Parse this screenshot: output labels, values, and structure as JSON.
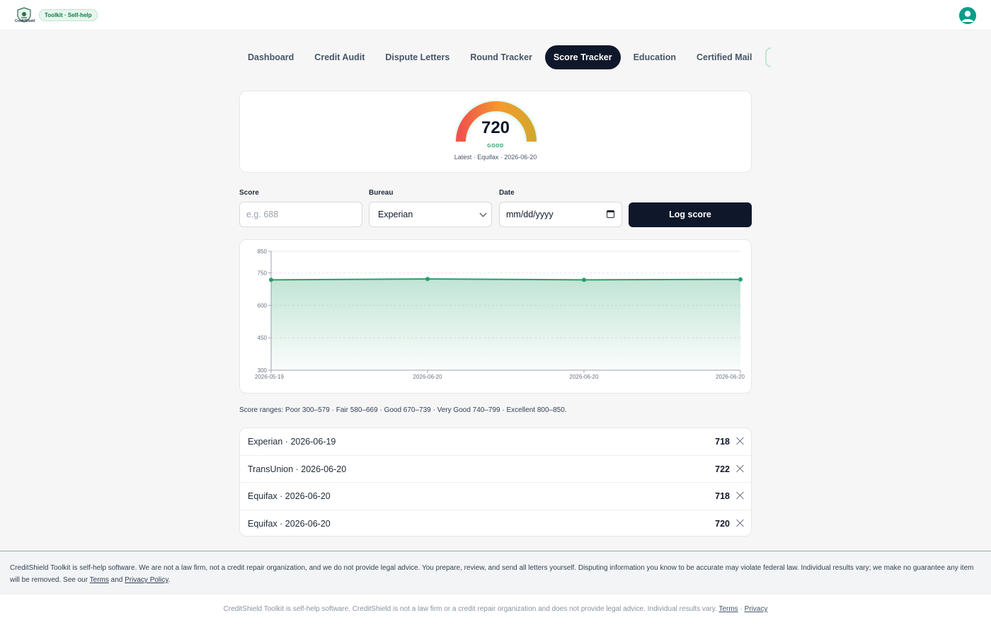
{
  "header": {
    "logo_text": "CreditShield",
    "badge": "Toolkit · Self-help",
    "colors": {
      "accent": "#22a06b",
      "dark": "#0f172a"
    }
  },
  "tabs": [
    {
      "label": "Dashboard",
      "active": false
    },
    {
      "label": "Credit Audit",
      "active": false
    },
    {
      "label": "Dispute Letters",
      "active": false
    },
    {
      "label": "Round Tracker",
      "active": false
    },
    {
      "label": "Score Tracker",
      "active": true
    },
    {
      "label": "Education",
      "active": false
    },
    {
      "label": "Certified Mail",
      "active": false
    }
  ],
  "gauge": {
    "score": "720",
    "rating": "GOOD",
    "caption": "Latest · Equifax · 2026-06-20"
  },
  "form": {
    "score_label": "Score",
    "score_placeholder": "e.g. 688",
    "bureau_label": "Bureau",
    "bureau_value": "Experian",
    "date_label": "Date",
    "date_placeholder": "mm/dd/yyyy",
    "submit_label": "Log score"
  },
  "chart_data": {
    "type": "area",
    "x": [
      "2026-05-19",
      "2026-06-20",
      "2026-06-20",
      "2026-06-20"
    ],
    "series": [
      {
        "values": [
          718,
          722,
          718,
          720
        ]
      }
    ],
    "ylim": [
      300,
      850
    ],
    "yticks": [
      "850",
      "750",
      "600",
      "450",
      "300"
    ],
    "grid": true,
    "color": "#22a06b"
  },
  "ranges_text": "Score ranges: Poor 300–579 · Fair 580–669 · Good 670–739 · Very Good 740–799 · Excellent 800–850.",
  "entries": [
    {
      "label": "Experian · 2026-06-19",
      "score": "718"
    },
    {
      "label": "TransUnion · 2026-06-20",
      "score": "722"
    },
    {
      "label": "Equifax · 2026-06-20",
      "score": "718"
    },
    {
      "label": "Equifax · 2026-06-20",
      "score": "720"
    }
  ],
  "disclaimer": {
    "text_1": "CreditShield Toolkit is self-help software. We are not a law firm, not a credit repair organization, and we do not provide legal advice. You prepare, review, and send all letters yourself. Disputing information you know to be accurate may violate federal law. Individual results vary; we make no guarantee any item will be removed. See our ",
    "terms": "Terms",
    "and": " and ",
    "privacy": "Privacy Policy",
    "end": "."
  },
  "footer": {
    "text": "CreditShield Toolkit is self-help software. CreditShield is not a law firm or a credit repair organization and does not provide legal advice. Individual results vary. ",
    "terms": "Terms",
    "sep": " · ",
    "privacy": "Privacy"
  }
}
